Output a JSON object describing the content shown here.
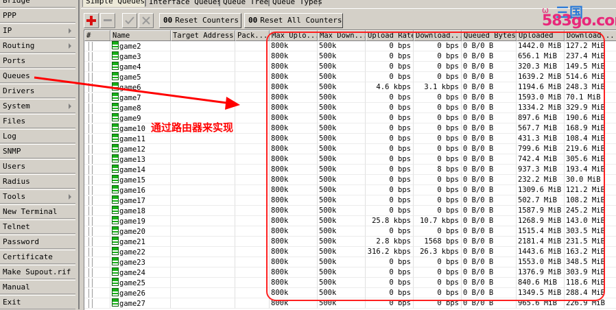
{
  "sidebar": {
    "items": [
      {
        "label": "Bridge",
        "submenu": false
      },
      {
        "label": "PPP",
        "submenu": false
      },
      {
        "label": "IP",
        "submenu": true
      },
      {
        "label": "Routing",
        "submenu": true
      },
      {
        "label": "Ports",
        "submenu": false
      },
      {
        "label": "Queues",
        "submenu": false
      },
      {
        "label": "Drivers",
        "submenu": false
      },
      {
        "label": "System",
        "submenu": true
      },
      {
        "label": "Files",
        "submenu": false
      },
      {
        "label": "Log",
        "submenu": false
      },
      {
        "label": "SNMP",
        "submenu": false
      },
      {
        "label": "Users",
        "submenu": false
      },
      {
        "label": "Radius",
        "submenu": false
      },
      {
        "label": "Tools",
        "submenu": true
      },
      {
        "label": "New Terminal",
        "submenu": false
      },
      {
        "label": "Telnet",
        "submenu": false
      },
      {
        "label": "Password",
        "submenu": false
      },
      {
        "label": "Certificate",
        "submenu": false
      },
      {
        "label": "Make Supout.rif",
        "submenu": false
      },
      {
        "label": "Manual",
        "submenu": false
      },
      {
        "label": "Exit",
        "submenu": false
      }
    ]
  },
  "tabs": [
    {
      "label": "Simple Queues",
      "active": true
    },
    {
      "label": "Interface Queues",
      "active": false
    },
    {
      "label": "Queue Tree",
      "active": false
    },
    {
      "label": "Queue Types",
      "active": false
    }
  ],
  "toolbar": {
    "add_icon": "plus-icon",
    "remove_icon": "minus-icon",
    "enable_icon": "check-icon",
    "disable_icon": "x-icon",
    "reset_counters_prefix": "00",
    "reset_counters_label": "Reset Counters",
    "reset_all_prefix": "00",
    "reset_all_label": "Reset All Counters"
  },
  "table": {
    "columns": [
      "#",
      "Name",
      "Target Address",
      "Pack...",
      "Max Uplo...",
      "Max Down...",
      "Upload Rate",
      "Download...",
      "Queued Bytes",
      "Uploaded",
      "Download..."
    ],
    "rows": [
      [
        "game2",
        "",
        "",
        "800k",
        "500k",
        "0 bps",
        "0 bps",
        "0 B/0 B",
        "1442.0 MiB",
        "127.2 MiB"
      ],
      [
        "game3",
        "",
        "",
        "800k",
        "500k",
        "0 bps",
        "0 bps",
        "0 B/0 B",
        "656.1 MiB",
        "237.4 MiB"
      ],
      [
        "game4",
        "",
        "",
        "800k",
        "500k",
        "0 bps",
        "0 bps",
        "0 B/0 B",
        "320.3 MiB",
        "149.5 MiB"
      ],
      [
        "game5",
        "",
        "",
        "800k",
        "500k",
        "0 bps",
        "0 bps",
        "0 B/0 B",
        "1639.2 MiB",
        "514.6 MiB"
      ],
      [
        "game6",
        "",
        "",
        "800k",
        "500k",
        "4.6 kbps",
        "3.1 kbps",
        "0 B/0 B",
        "1194.6 MiB",
        "248.3 MiB"
      ],
      [
        "game7",
        "",
        "",
        "800k",
        "500k",
        "0 bps",
        "0 bps",
        "0 B/0 B",
        "1593.0 MiB",
        "70.1 MiB"
      ],
      [
        "game8",
        "",
        "",
        "800k",
        "500k",
        "0 bps",
        "0 bps",
        "0 B/0 B",
        "1334.2 MiB",
        "329.9 MiB"
      ],
      [
        "game9",
        "",
        "",
        "800k",
        "500k",
        "0 bps",
        "0 bps",
        "0 B/0 B",
        "897.6 MiB",
        "190.6 MiB"
      ],
      [
        "game10",
        "",
        "",
        "800k",
        "500k",
        "0 bps",
        "0 bps",
        "0 B/0 B",
        "567.7 MiB",
        "168.9 MiB"
      ],
      [
        "game11",
        "",
        "",
        "800k",
        "500k",
        "0 bps",
        "0 bps",
        "0 B/0 B",
        "431.3 MiB",
        "108.4 MiB"
      ],
      [
        "game12",
        "",
        "",
        "800k",
        "500k",
        "0 bps",
        "0 bps",
        "0 B/0 B",
        "799.6 MiB",
        "219.6 MiB"
      ],
      [
        "game13",
        "",
        "",
        "800k",
        "500k",
        "0 bps",
        "0 bps",
        "0 B/0 B",
        "742.4 MiB",
        "305.6 MiB"
      ],
      [
        "game14",
        "",
        "",
        "800k",
        "500k",
        "0 bps",
        "8 bps",
        "0 B/0 B",
        "937.3 MiB",
        "193.4 MiB"
      ],
      [
        "game15",
        "",
        "",
        "800k",
        "500k",
        "0 bps",
        "0 bps",
        "0 B/0 B",
        "232.2 MiB",
        "30.0 MiB"
      ],
      [
        "game16",
        "",
        "",
        "800k",
        "500k",
        "0 bps",
        "0 bps",
        "0 B/0 B",
        "1309.6 MiB",
        "121.2 MiB"
      ],
      [
        "game17",
        "",
        "",
        "800k",
        "500k",
        "0 bps",
        "0 bps",
        "0 B/0 B",
        "502.7 MiB",
        "108.2 MiB"
      ],
      [
        "game18",
        "",
        "",
        "800k",
        "500k",
        "0 bps",
        "0 bps",
        "0 B/0 B",
        "1587.9 MiB",
        "245.2 MiB"
      ],
      [
        "game19",
        "",
        "",
        "800k",
        "500k",
        "25.8 kbps",
        "10.7 kbps",
        "0 B/0 B",
        "1268.9 MiB",
        "143.0 MiB"
      ],
      [
        "game20",
        "",
        "",
        "800k",
        "500k",
        "0 bps",
        "0 bps",
        "0 B/0 B",
        "1515.4 MiB",
        "303.5 MiB"
      ],
      [
        "game21",
        "",
        "",
        "800k",
        "500k",
        "2.8 kbps",
        "1568 bps",
        "0 B/0 B",
        "2181.4 MiB",
        "231.5 MiB"
      ],
      [
        "game22",
        "",
        "",
        "800k",
        "500k",
        "316.2 kbps",
        "26.3 kbps",
        "0 B/0 B",
        "1443.6 MiB",
        "163.2 MiB"
      ],
      [
        "game23",
        "",
        "",
        "800k",
        "500k",
        "0 bps",
        "0 bps",
        "0 B/0 B",
        "1553.0 MiB",
        "348.5 MiB"
      ],
      [
        "game24",
        "",
        "",
        "800k",
        "500k",
        "0 bps",
        "0 bps",
        "0 B/0 B",
        "1376.9 MiB",
        "303.9 MiB"
      ],
      [
        "game25",
        "",
        "",
        "800k",
        "500k",
        "0 bps",
        "0 bps",
        "0 B/0 B",
        "840.6 MiB",
        "118.6 MiB"
      ],
      [
        "game26",
        "",
        "",
        "800k",
        "500k",
        "0 bps",
        "0 bps",
        "0 B/0 B",
        "1349.5 MiB",
        "288.4 MiB"
      ],
      [
        "game27",
        "",
        "",
        "800k",
        "500k",
        "0 bps",
        "0 bps",
        "0 B/0 B",
        "965.6 MiB",
        "226.9 MiB"
      ]
    ]
  },
  "annotation": {
    "text": "通过路由器来实现",
    "color": "#ff0000"
  },
  "watermark": {
    "swirl": "ω",
    "sub": "三国",
    "main": "583go.com"
  },
  "colors": {
    "accent": "#ff0000",
    "queue_icon": "#18b018"
  }
}
